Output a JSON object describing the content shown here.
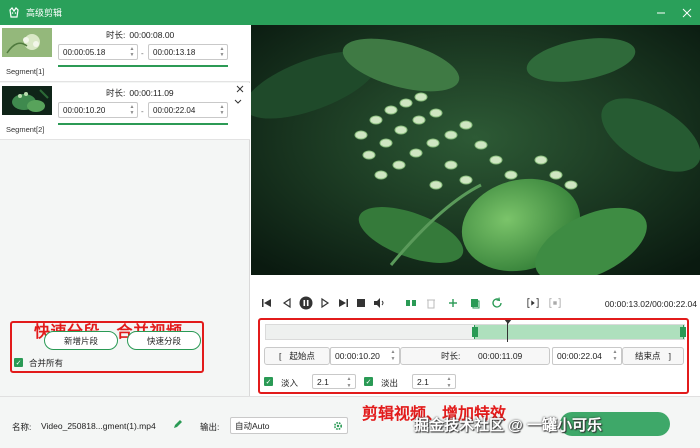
{
  "window": {
    "title": "高级剪辑",
    "minimize_icon": "minimize-icon",
    "close_icon": "close-icon"
  },
  "segments": [
    {
      "label": "Segment[1]",
      "duration_label": "时长:",
      "duration": "00:00:08.00",
      "start": "00:00:05.18",
      "end": "00:00:13.18",
      "progress_start": 0.0,
      "progress_end": 1.0
    },
    {
      "label": "Segment[2]",
      "duration_label": "时长:",
      "duration": "00:00:11.09",
      "start": "00:00:10.20",
      "end": "00:00:22.04",
      "progress_start": 0.0,
      "progress_end": 1.0,
      "close_icon": "close-icon"
    }
  ],
  "left_panel": {
    "annotation": "快速分段、合并视频",
    "add_segment_button": "新增片段",
    "quick_split_button": "快速分段",
    "merge_all_label": "合并所有",
    "merge_all_checked": true
  },
  "player": {
    "current_time": "00:00:13.02/00:00:22.04",
    "controls": [
      "skip-to-start-icon",
      "step-back-icon",
      "pause-icon",
      "step-forward-icon",
      "skip-to-end-icon",
      "volume-icon",
      "split-icon",
      "delete-icon",
      "add-icon",
      "copy-icon",
      "reset-icon",
      "crop-in-icon",
      "crop-out-icon"
    ]
  },
  "timeline": {
    "selection_start": 0.5,
    "selection_end": 1.0,
    "playhead": 0.58
  },
  "trim": {
    "start_button": "起始点",
    "start_time": "00:00:10.20",
    "duration_label": "时长:",
    "duration": "00:00:11.09",
    "end_time": "00:00:22.04",
    "end_button": "结束点",
    "fade_in_label": "淡入",
    "fade_in_value": "2.1",
    "fade_in_checked": true,
    "fade_out_label": "淡出",
    "fade_out_value": "2.1",
    "fade_out_checked": true,
    "annotation": "剪辑视频、增加特效"
  },
  "bottom": {
    "name_label": "名称:",
    "name_value": "Video_250818...gment(1).mp4",
    "output_label": "输出:",
    "output_value": "自动Auto"
  },
  "watermark": "掘金技术社区 @ 一罐小可乐",
  "colors": {
    "accent": "#2aa05a",
    "annotation": "#e21b1b"
  }
}
